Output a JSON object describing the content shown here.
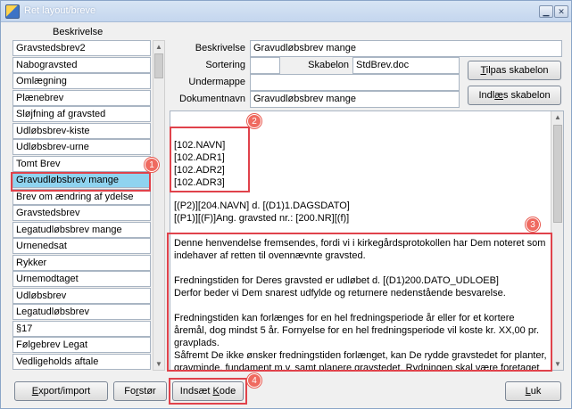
{
  "window": {
    "title": "Ret layout/breve"
  },
  "list": {
    "header": "Beskrivelse",
    "items": [
      "Gravstedsbrev2",
      "Nabogravsted",
      "Omlægning",
      "Plænebrev",
      "Sløjfning af gravsted",
      "Udløbsbrev-kiste",
      "Udløbsbrev-urne",
      "Tomt Brev",
      "Gravudløbsbrev mange",
      "Brev om ændring af ydelse",
      "Gravstedsbrev",
      "Legatudløbsbrev mange",
      "Urnenedsat",
      "Rykker",
      "Urnemodtaget",
      "Udløbsbrev",
      "Legatudløbsbrev",
      "§17",
      "Følgebrev Legat",
      "Vedligeholds aftale"
    ],
    "selected": "Gravudløbsbrev mange"
  },
  "form": {
    "beskrivelse_label": "Beskrivelse",
    "beskrivelse_value": "Gravudløbsbrev mange",
    "sortering_label": "Sortering",
    "sortering_value": "",
    "skabelon_label": "Skabelon",
    "skabelon_value": "StdBrev.doc",
    "undermappe_label": "Undermappe",
    "undermappe_value": "",
    "dokumentnavn_label": "Dokumentnavn",
    "dokumentnavn_value": "Gravudløbsbrev mange"
  },
  "buttons": {
    "tilpas_pre": "",
    "tilpas_u": "T",
    "tilpas_post": "ilpas skabelon",
    "indlaes_pre": "Indl",
    "indlaes_u": "æ",
    "indlaes_post": "s skabelon",
    "export_pre": "",
    "export_u": "E",
    "export_post": "xport/import",
    "forstor_pre": "Fo",
    "forstor_u": "r",
    "forstor_post": "stør",
    "indsaet_pre": "Indsæt ",
    "indsaet_u": "K",
    "indsaet_post": "ode",
    "luk_pre": "",
    "luk_u": "L",
    "luk_post": "uk"
  },
  "document": {
    "lines": [
      "[102.NAVN]",
      "[102.ADR1]",
      "[102.ADR2]",
      "[102.ADR3]",
      "[(P2)][204.NAVN] d. [(D1)1.DAGSDATO]",
      "[(P1)][(F)]Ang. gravsted nr.: [200.NR][(f)]",
      "Denne henvendelse fremsendes, fordi vi i kirkegårdsprotokollen har Dem noteret som",
      "indehaver af retten til ovennævnte gravsted.",
      "Fredningstiden for Deres gravsted er udløbet d. [(D1)200.DATO_UDLOEB]",
      "Derfor beder vi Dem snarest udfylde og returnere nedenstående besvarelse.",
      "Fredningstiden kan forlænges for en hel fredningsperiode  år eller for et kortere",
      "åremål, dog mindst 5 år. Fornyelse for en hel fredningsperiode vil koste kr. XX,00 pr.",
      "gravplads.",
      "Såfremt De ikke ønsker fredningstiden forlænget, kan De rydde gravstedet for planter,",
      "gravminde, fundament m.v. samt planere gravstedet. Rydningen skal være foretaget"
    ]
  },
  "annotations": {
    "badge1": "1",
    "badge2": "2",
    "badge3": "3",
    "badge4": "4",
    "color": "#e0424b"
  }
}
